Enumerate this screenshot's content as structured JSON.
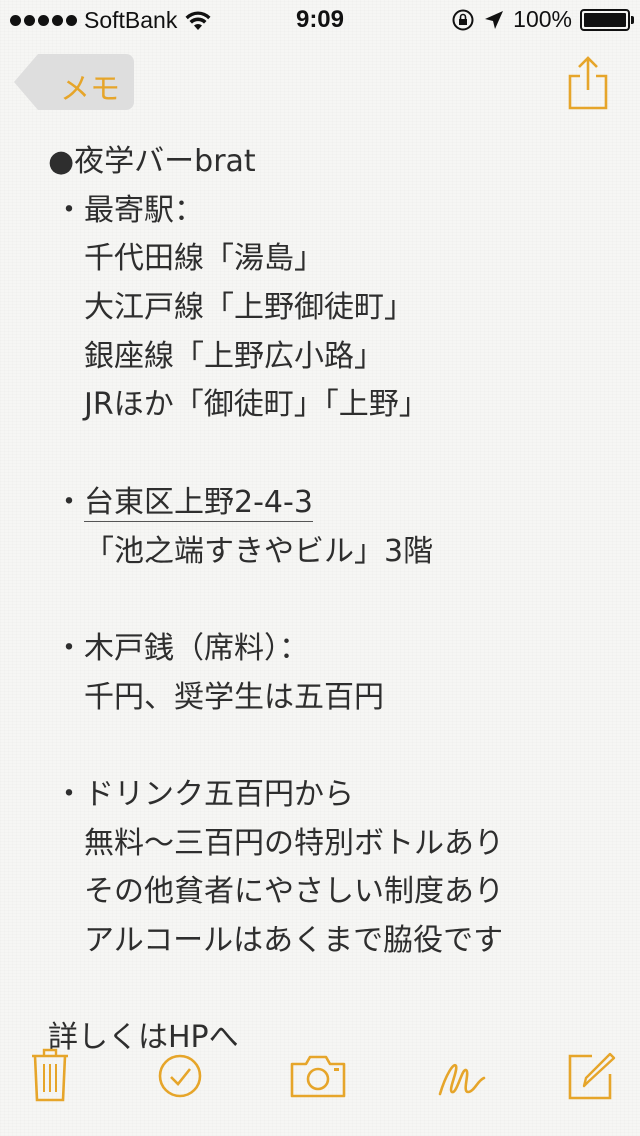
{
  "status_bar": {
    "carrier": "SoftBank",
    "time": "9:09",
    "battery": "100%"
  },
  "nav": {
    "back_label": "メモ",
    "share_icon": "share-icon"
  },
  "note": {
    "lines": [
      "●夜学バーbrat",
      "・最寄駅：",
      "千代田線「湯島」",
      "大江戸線「上野御徒町」",
      "銀座線「上野広小路」",
      "JRほか「御徒町」「上野」",
      "",
      "・",
      "台東区上野2-4-3",
      "「池之端すきやビル」3階",
      "",
      "・木戸銭（席料）：",
      "千円、奨学生は五百円",
      "",
      "・ドリンク五百円から",
      "無料〜三百円の特別ボトルあり",
      "その他貧者にやさしい制度あり",
      "アルコールはあくまで脇役です",
      "",
      "詳しくはHPへ"
    ]
  },
  "toolbar": {
    "icons": [
      "trash-icon",
      "checklist-icon",
      "camera-icon",
      "sketch-icon",
      "compose-icon"
    ]
  },
  "colors": {
    "accent": "#e6a52a",
    "text": "#2e2e2e",
    "background": "#f6f6f4"
  }
}
